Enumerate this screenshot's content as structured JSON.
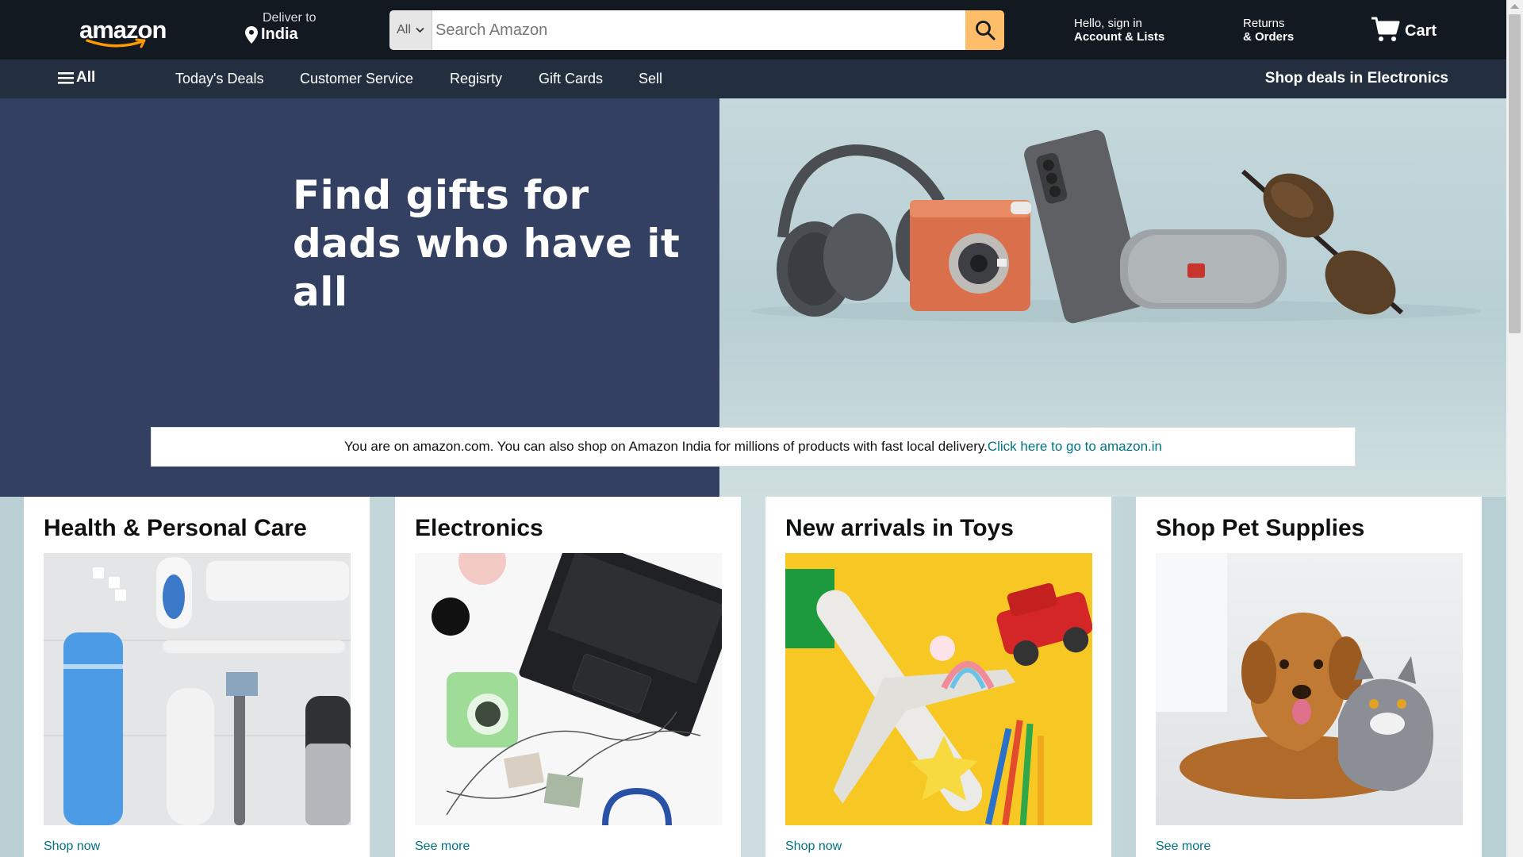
{
  "header": {
    "logo_text": "amazon",
    "deliver_label": "Deliver to",
    "deliver_location": "India",
    "search_category": "All",
    "search_placeholder": "Search Amazon",
    "account_line1": "Hello, sign in",
    "account_line2": "Account & Lists",
    "returns_line1": "Returns",
    "returns_line2": "& Orders",
    "cart_label": "Cart"
  },
  "subnav": {
    "all_label": "All",
    "items": [
      "Today's Deals",
      "Customer Service",
      "Regisrty",
      "Gift Cards",
      "Sell"
    ],
    "promo": "Shop deals in Electronics"
  },
  "hero": {
    "title_line1": "Find gifts for",
    "title_line2": "dads who have it all"
  },
  "notice": {
    "text": "You are on amazon.com. You can also shop on Amazon India for millions of products with fast local delivery.",
    "link": "Click here to go to amazon.in"
  },
  "cards": [
    {
      "title": "Health & Personal Care",
      "link": "Shop now"
    },
    {
      "title": "Electronics",
      "link": "See more"
    },
    {
      "title": "New arrivals in Toys",
      "link": "Shop now"
    },
    {
      "title": "Shop Pet Supplies",
      "link": "See more"
    }
  ],
  "colors": {
    "topbar": "#131921",
    "subnav": "#232f3e",
    "hero_left": "#334062",
    "search_button": "#febd69",
    "link": "#007185"
  }
}
